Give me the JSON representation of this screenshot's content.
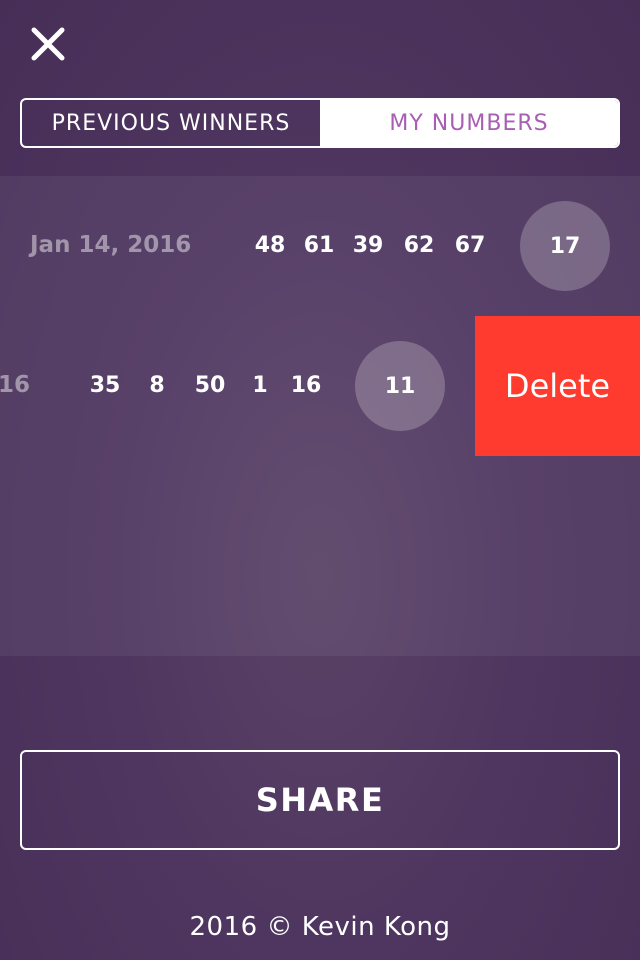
{
  "header": {
    "close_icon": "close-icon"
  },
  "tabs": [
    {
      "label": "PREVIOUS WINNERS",
      "selected": false
    },
    {
      "label": "MY NUMBERS",
      "selected": true
    }
  ],
  "entries": [
    {
      "date": "Jan 14, 2016",
      "numbers": [
        "48",
        "61",
        "39",
        "62",
        "67"
      ],
      "power_ball": "17"
    },
    {
      "date_visible_fragment": "16",
      "numbers": [
        "35",
        "8",
        "50",
        "1",
        "16"
      ],
      "power_ball": "11",
      "swipe_action": "Delete"
    }
  ],
  "share_button": {
    "label": "SHARE"
  },
  "footer": {
    "text": "2016 © Kevin Kong"
  },
  "colors": {
    "background": "#4e3660",
    "tab_active_text": "#a85fb3",
    "delete": "#ff3b30",
    "text": "#ffffff"
  }
}
